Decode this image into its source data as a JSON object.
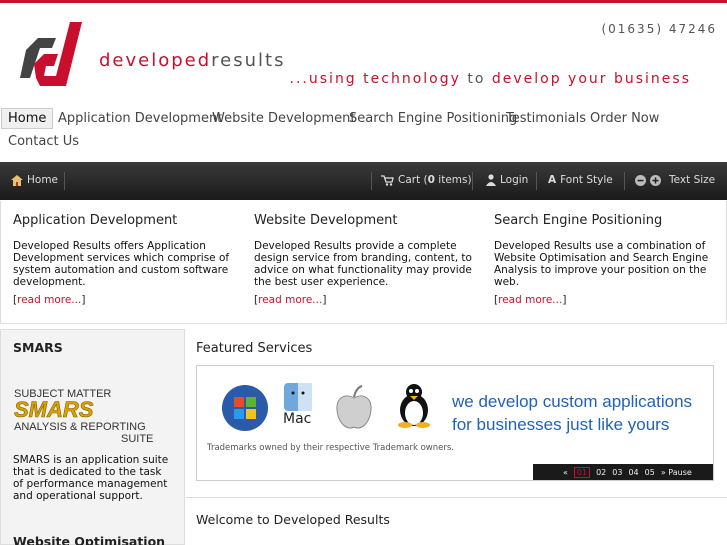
{
  "header": {
    "phone": "(01635) 47246",
    "brand_part1": "developed",
    "brand_part2": "results",
    "tagline_part1": "...using technology ",
    "tagline_to": "to",
    "tagline_part2": " develop your business"
  },
  "nav": {
    "items": [
      "Home",
      "Application Development",
      "Website Development",
      "Search Engine Positioning",
      "Testimonials",
      "Order Now",
      "Contact Us"
    ]
  },
  "toolbar": {
    "home": "Home",
    "cart_prefix": "Cart (",
    "cart_count": "0",
    "cart_suffix": " items)",
    "login": "Login",
    "font_style": "Font Style",
    "text_size": "Text Size"
  },
  "columns": [
    {
      "title": "Application Development",
      "body": "Developed Results offers Application Development services which comprise of system automation and custom software development.",
      "more": "read more..."
    },
    {
      "title": "Website Development",
      "body": "Developed Results provide a complete design service from branding, content, to advice on what functionality may provide the best user experience.",
      "more": "read more..."
    },
    {
      "title": "Search Engine Positioning",
      "body": "Developed Results use a combination of Website Optimisation and Search Engine Analysis to improve your position on the web.",
      "more": "read more..."
    }
  ],
  "sidebar": {
    "heading": "SMARS",
    "logo_line1": "SUBJECT MATTER",
    "logo_word": "SMARS",
    "logo_line3": "ANALYSIS & REPORTING",
    "logo_line4": "SUITE",
    "description": "SMARS is an application suite that is dedicated to the task of performance management and operational support.",
    "next_heading": "Website Optimisation"
  },
  "main": {
    "featured_title": "Featured Services",
    "slogan_line1": "we develop custom applications",
    "slogan_line2": "for businesses just like yours",
    "trademark": "Trademarks owned by their respective Trademark owners.",
    "mac_label": "Mac",
    "pager": [
      "«",
      "01",
      "02",
      "03",
      "04",
      "05",
      "» Pause"
    ],
    "welcome": "Welcome to Developed Results"
  },
  "colors": {
    "accent": "#c8102e",
    "slogan_blue": "#1f63b8",
    "toolbar_dark": "#1a1a1a"
  },
  "icons": [
    "home-icon",
    "cart-icon",
    "user-icon",
    "font-style-icon",
    "text-smaller-icon",
    "text-larger-icon",
    "windows-logo-icon",
    "mac-finder-icon",
    "apple-logo-icon",
    "linux-tux-icon"
  ]
}
